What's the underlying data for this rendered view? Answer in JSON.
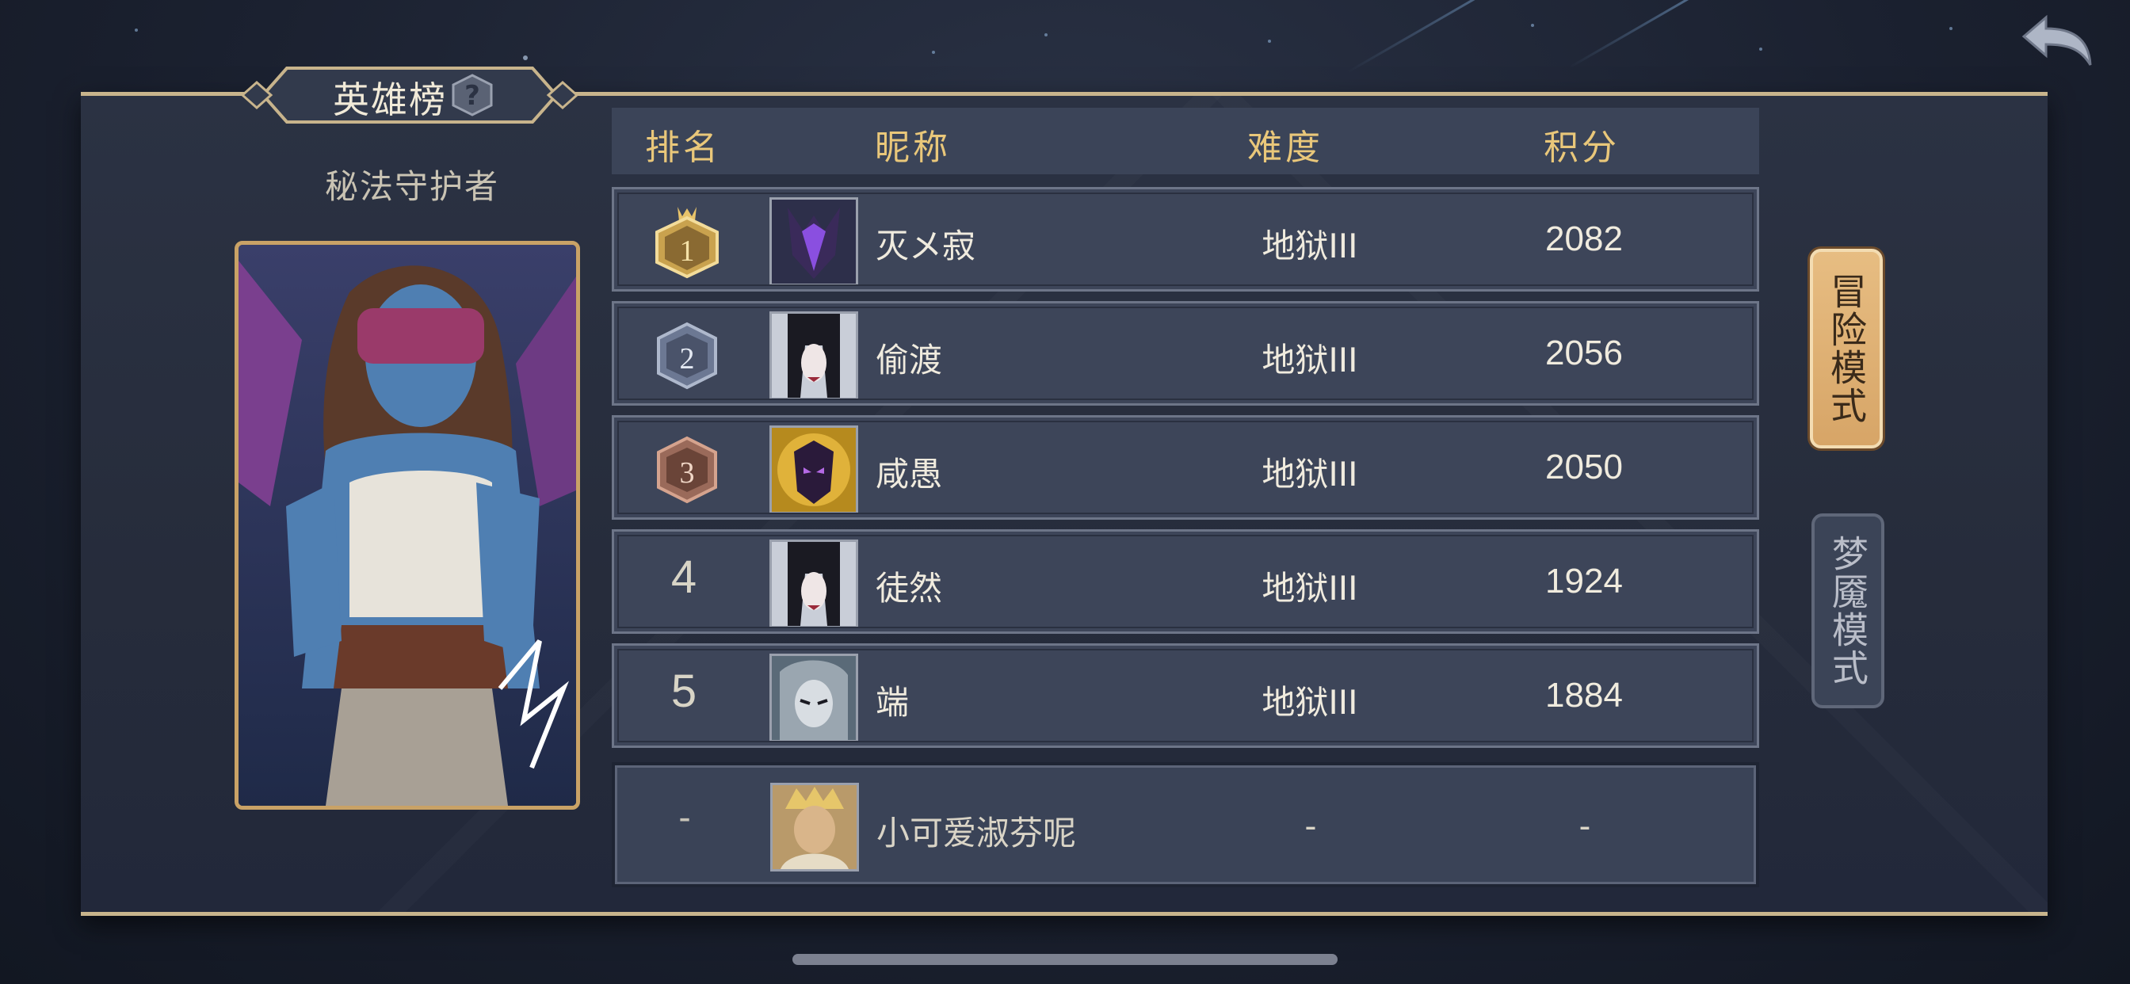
{
  "title": "英雄榜",
  "hero_name": "秘法守护者",
  "columns": [
    "排名",
    "昵称",
    "难度",
    "积分"
  ],
  "rows": [
    {
      "rank": "1",
      "nickname": "灭メ寂",
      "difficulty": "地狱III",
      "score": "2082",
      "medal": "gold-crown-medal-icon"
    },
    {
      "rank": "2",
      "nickname": "偷渡",
      "difficulty": "地狱III",
      "score": "2056",
      "medal": "silver-medal-icon"
    },
    {
      "rank": "3",
      "nickname": "咸愚",
      "difficulty": "地狱III",
      "score": "2050",
      "medal": "bronze-medal-icon"
    },
    {
      "rank": "4",
      "nickname": "徒然",
      "difficulty": "地狱III",
      "score": "1924"
    },
    {
      "rank": "5",
      "nickname": "端",
      "difficulty": "地狱III",
      "score": "1884"
    }
  ],
  "my_entry": {
    "rank": "-",
    "nickname": "小可爱淑芬呢",
    "difficulty": "-",
    "score": "-"
  },
  "modes": [
    {
      "label": "冒险模式",
      "active": true
    },
    {
      "label": "梦魇模式",
      "active": false
    }
  ],
  "colors": {
    "accent_gold": "#e9c77a",
    "active_tab": "#e2b478",
    "panel": "#2b3243",
    "row": "#3d4559"
  }
}
